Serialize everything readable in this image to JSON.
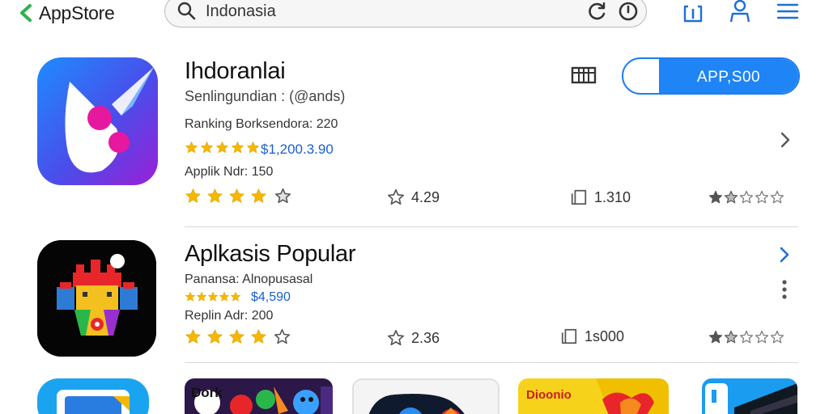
{
  "header": {
    "brand": "AppStore",
    "search_value": "Indonasia"
  },
  "apps": [
    {
      "title": "Ihdoranlai",
      "subtitle": "Senlingundian : (@ands)",
      "ranking": "Ranking Borksendora: 220",
      "price": "$1,200.3.90",
      "appl": "Applik Ndr: 150",
      "rating_value": "4.29",
      "downloads": "1.310",
      "get_label": "APP,S00"
    },
    {
      "title": "Aplkasis Popular",
      "subtitle": "Panansa: Alnopusasal",
      "price": "$4,590",
      "appl": "Replin Adr: 200",
      "rating_value": "2.36",
      "downloads": "1s000"
    }
  ],
  "thumbnails": [
    {
      "label": "Dork"
    },
    {
      "label": ""
    },
    {
      "label": "Dioonio"
    },
    {
      "label": ""
    }
  ],
  "colors": {
    "accent": "#1f84f5",
    "star": "#f5b800",
    "price": "#1a5fd0"
  }
}
